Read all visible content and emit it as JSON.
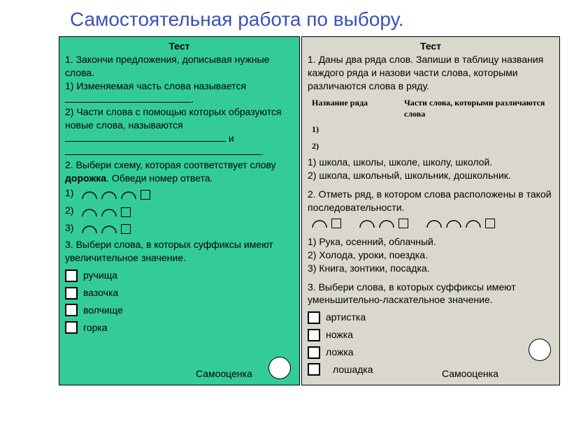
{
  "title": "Самостоятельная работа по выбору.",
  "left": {
    "head": "Тест",
    "q1_line1": "1. Закончи предложения, дописывая нужные слова.",
    "q1_p1a": "1) Изменяемая часть слова называется",
    "q1_p1_blank_trail": ".",
    "q1_p2a": "2) Части слова с помощью которых образуются новые слова, называются",
    "q1_p2_join": " и",
    "q1_p2_blank_trail2": ".",
    "q2a": "2. Выбери схему, которая соответствует слову ",
    "q2_word": "дорожка",
    "q2b": ". Обведи номер ответа.",
    "opt1": "1)",
    "opt2": "2)",
    "opt3": "3)",
    "q3": "3. Выбери слова, в которых суффиксы имеют увеличительное значение.",
    "w1": "ручища",
    "w2": "вазочка",
    "w3": "волчище",
    "w4": "горка",
    "self": "Самооценка"
  },
  "right": {
    "head": "Тест",
    "q1": "1. Даны два ряда слов. Запиши в таблицу названия каждого ряда и назови части слова, которыми различаются слова в ряду.",
    "th1": "Название ряда",
    "th2": "Части слова, которыми различаются слова",
    "r1": "1)",
    "r2": "2)",
    "row1": "1) школа, школы, школе, школу, школой.",
    "row2": "2) школа, школьный, школьник, дошкольник.",
    "q2": "2. Отметь ряд, в котором слова расположены в такой последовательности.",
    "ans1": "1) Рука, осенний, облачный.",
    "ans2": "2) Холода, уроки, поездка.",
    "ans3": "3) Книга, зонтики, посадка.",
    "q3": "3. Выбери слова, в которых суффиксы имеют уменьшительно-ласкательное значение.",
    "w1": "артистка",
    "w2": "ножка",
    "w3": "ложка",
    "w4": "лошадка",
    "self": "Самооценка"
  }
}
